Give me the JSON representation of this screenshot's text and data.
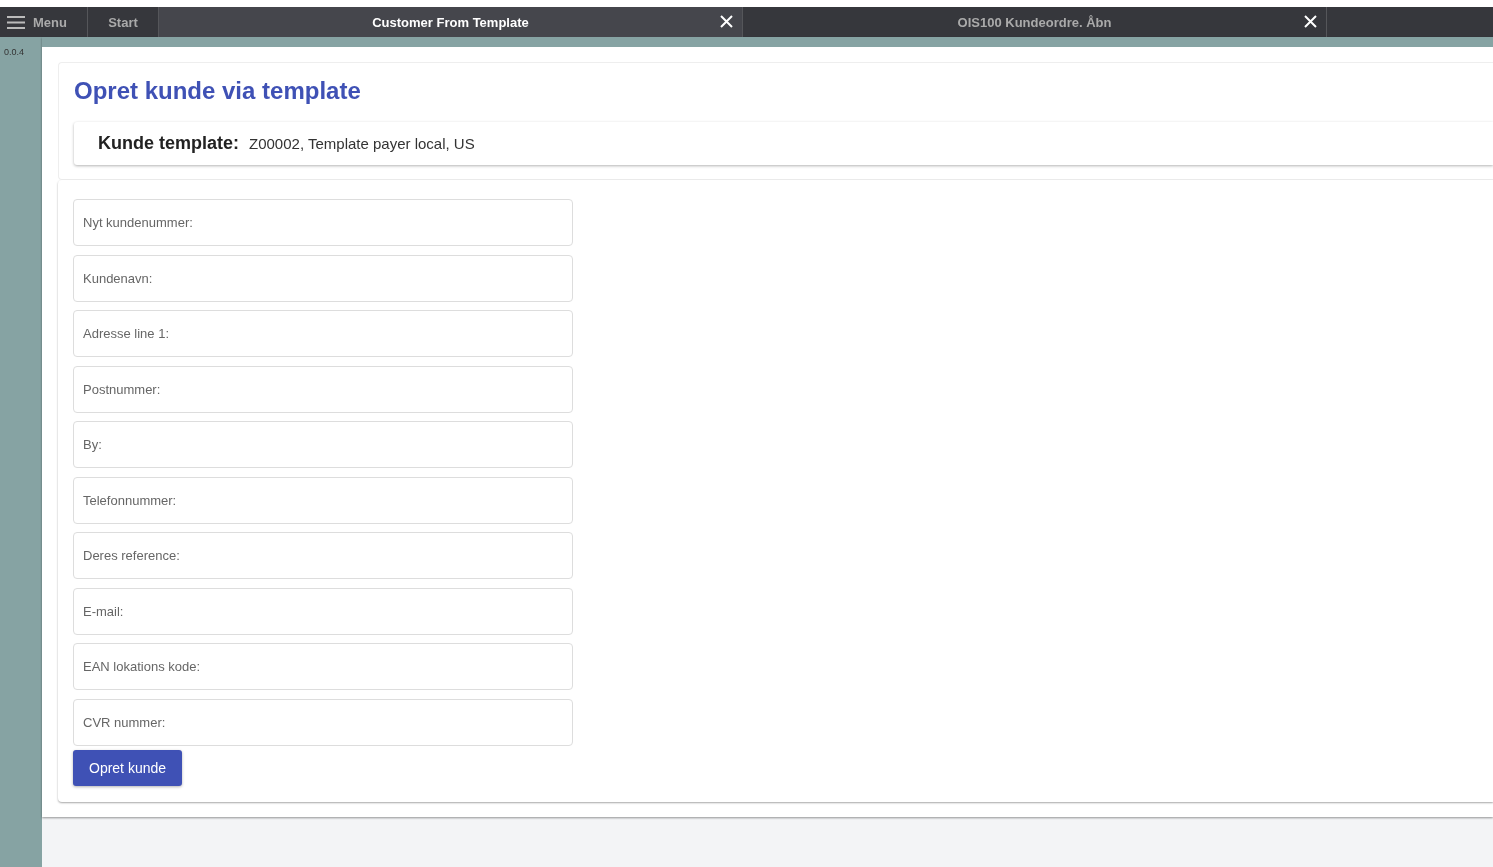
{
  "tab_bar": {
    "menu": {
      "label": "Menu"
    },
    "tabs": [
      {
        "label": "Start",
        "selected": false,
        "closable": false
      },
      {
        "label": "Customer From Template",
        "selected": true,
        "closable": true
      },
      {
        "label": "OIS100 Kundeordre. Åbn",
        "selected": false,
        "closable": true
      }
    ]
  },
  "version": "0.0.4",
  "page": {
    "title": "Opret kunde via template",
    "template": {
      "label": "Kunde template:",
      "value": "Z00002, Template payer local, US"
    },
    "fields": [
      {
        "placeholder": "Nyt kundenummer:"
      },
      {
        "placeholder": "Kundenavn:"
      },
      {
        "placeholder": "Adresse line 1:"
      },
      {
        "placeholder": "Postnummer:"
      },
      {
        "placeholder": "By:"
      },
      {
        "placeholder": "Telefonnummer:"
      },
      {
        "placeholder": "Deres reference:"
      },
      {
        "placeholder": "E-mail:"
      },
      {
        "placeholder": "EAN lokations kode:"
      },
      {
        "placeholder": "CVR nummer:"
      }
    ],
    "submit": "Opret kunde"
  }
}
